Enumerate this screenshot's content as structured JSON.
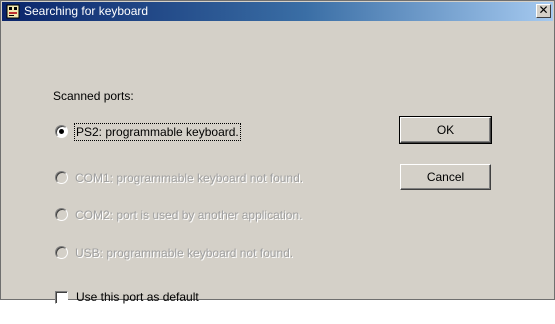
{
  "window": {
    "title": "Searching for keyboard",
    "close_symbol": "✕"
  },
  "scanned_ports_label": "Scanned ports:",
  "ports": [
    {
      "label": "PS2: programmable keyboard.",
      "selected": true,
      "enabled": true
    },
    {
      "label": "COM1: programmable keyboard not found.",
      "selected": false,
      "enabled": false
    },
    {
      "label": "COM2: port is used by another application.",
      "selected": false,
      "enabled": false
    },
    {
      "label": "USB: programmable keyboard not found.",
      "selected": false,
      "enabled": false
    }
  ],
  "default_checkbox": {
    "label": "Use this port as default",
    "checked": false
  },
  "buttons": {
    "ok": "OK",
    "cancel": "Cancel"
  },
  "colors": {
    "disabled_text": "#a0a0a0",
    "dialog_bg": "#d4d0c8"
  }
}
